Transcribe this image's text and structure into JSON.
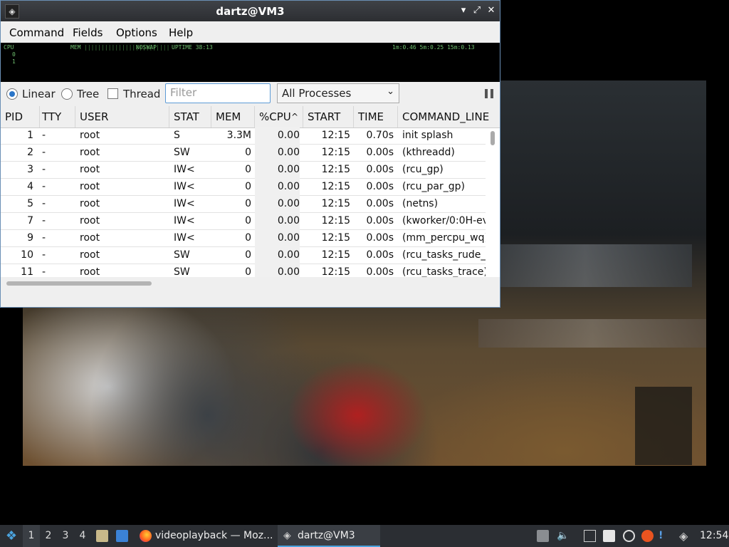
{
  "window": {
    "title": "dartz@VM3",
    "menu": [
      "Command",
      "Fields",
      "Options",
      "Help"
    ]
  },
  "meters": {
    "line1_left": "CPU",
    "line1_mem": "MEM",
    "line1_swap": "NOSWAP",
    "line1_uptime": "UPTIME 38:13",
    "line1_load": "1m:0.46 5m:0.25 15m:0.13",
    "line2": "0",
    "line3": "1"
  },
  "toolbar": {
    "linear_label": "Linear",
    "tree_label": "Tree",
    "thread_label": "Thread",
    "filter_placeholder": "Filter",
    "process_select": "All Processes",
    "view_mode": "Linear",
    "thread_checked": false
  },
  "columns": [
    "PID",
    "TTY",
    "USER",
    "STAT",
    "MEM",
    "%CPU",
    "START",
    "TIME",
    "COMMAND_LINE"
  ],
  "sort_column": "%CPU",
  "processes": [
    {
      "pid": "1",
      "tty": "-",
      "user": "root",
      "stat": "S",
      "mem": "3.3M",
      "cpu": "0.00",
      "start": "12:15",
      "time": "0.70s",
      "cmd": "init splash"
    },
    {
      "pid": "2",
      "tty": "-",
      "user": "root",
      "stat": "SW",
      "mem": "0",
      "cpu": "0.00",
      "start": "12:15",
      "time": "0.00s",
      "cmd": "(kthreadd)"
    },
    {
      "pid": "3",
      "tty": "-",
      "user": "root",
      "stat": "IW<",
      "mem": "0",
      "cpu": "0.00",
      "start": "12:15",
      "time": "0.00s",
      "cmd": "(rcu_gp)"
    },
    {
      "pid": "4",
      "tty": "-",
      "user": "root",
      "stat": "IW<",
      "mem": "0",
      "cpu": "0.00",
      "start": "12:15",
      "time": "0.00s",
      "cmd": "(rcu_par_gp)"
    },
    {
      "pid": "5",
      "tty": "-",
      "user": "root",
      "stat": "IW<",
      "mem": "0",
      "cpu": "0.00",
      "start": "12:15",
      "time": "0.00s",
      "cmd": "(netns)"
    },
    {
      "pid": "7",
      "tty": "-",
      "user": "root",
      "stat": "IW<",
      "mem": "0",
      "cpu": "0.00",
      "start": "12:15",
      "time": "0.00s",
      "cmd": "(kworker/0:0H-ev"
    },
    {
      "pid": "9",
      "tty": "-",
      "user": "root",
      "stat": "IW<",
      "mem": "0",
      "cpu": "0.00",
      "start": "12:15",
      "time": "0.00s",
      "cmd": "(mm_percpu_wq)"
    },
    {
      "pid": "10",
      "tty": "-",
      "user": "root",
      "stat": "SW",
      "mem": "0",
      "cpu": "0.00",
      "start": "12:15",
      "time": "0.00s",
      "cmd": "(rcu_tasks_rude_)"
    },
    {
      "pid": "11",
      "tty": "-",
      "user": "root",
      "stat": "SW",
      "mem": "0",
      "cpu": "0.00",
      "start": "12:15",
      "time": "0.00s",
      "cmd": "(rcu_tasks_trace)"
    }
  ],
  "taskbar": {
    "workspaces": [
      "1",
      "2",
      "3",
      "4"
    ],
    "current_workspace": "1",
    "tasks": [
      {
        "label": "videoplayback — Moz...",
        "icon": "firefox-icon"
      },
      {
        "label": "dartz@VM3",
        "icon": "htop-icon"
      }
    ],
    "clock": "12:54"
  },
  "colors": {
    "titlebar": "#2c2e32",
    "accent": "#2a75c8",
    "taskbar": "#2b2e33"
  }
}
